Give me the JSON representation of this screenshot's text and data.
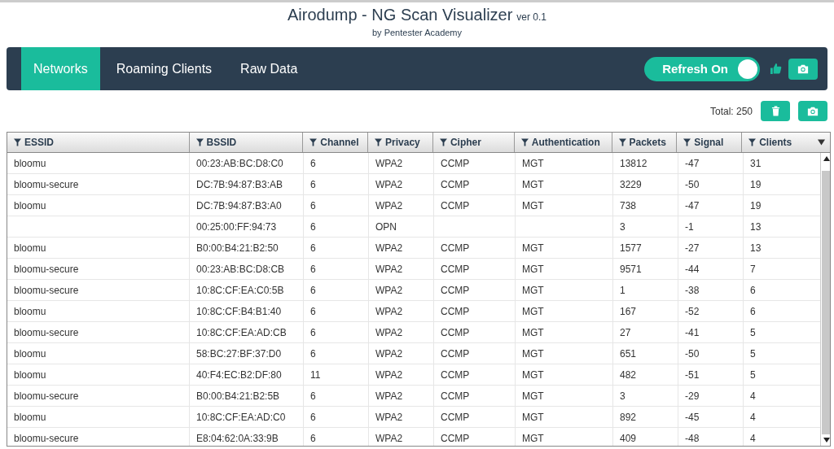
{
  "header": {
    "title": "Airodump - NG Scan Visualizer",
    "version": "ver 0.1",
    "subtitle": "by Pentester Academy"
  },
  "tabs": [
    {
      "label": "Networks",
      "selected": true
    },
    {
      "label": "Roaming Clients",
      "selected": false
    },
    {
      "label": "Raw Data",
      "selected": false
    }
  ],
  "refresh_toggle": {
    "label": "Refresh On",
    "on": true
  },
  "total": "Total: 250",
  "table": {
    "columns": [
      "ESSID",
      "BSSID",
      "Channel",
      "Privacy",
      "Cipher",
      "Authentication",
      "Packets",
      "Signal",
      "Clients"
    ],
    "rows": [
      {
        "essid": "bloomu",
        "bssid": "00:23:AB:BC:D8:C0",
        "channel": "6",
        "privacy": "WPA2",
        "cipher": "CCMP",
        "authentication": "MGT",
        "packets": "13812",
        "signal": "-47",
        "clients": "31"
      },
      {
        "essid": "bloomu-secure",
        "bssid": "DC:7B:94:87:B3:AB",
        "channel": "6",
        "privacy": "WPA2",
        "cipher": "CCMP",
        "authentication": "MGT",
        "packets": "3229",
        "signal": "-50",
        "clients": "19"
      },
      {
        "essid": "bloomu",
        "bssid": "DC:7B:94:87:B3:A0",
        "channel": "6",
        "privacy": "WPA2",
        "cipher": "CCMP",
        "authentication": "MGT",
        "packets": "738",
        "signal": "-47",
        "clients": "19"
      },
      {
        "bssid": "00:25:00:FF:94:73",
        "channel": "6",
        "privacy": "OPN",
        "packets": "3",
        "signal": "-1",
        "clients": "13"
      },
      {
        "essid": "bloomu",
        "bssid": "B0:00:B4:21:B2:50",
        "channel": "6",
        "privacy": "WPA2",
        "cipher": "CCMP",
        "authentication": "MGT",
        "packets": "1577",
        "signal": "-27",
        "clients": "13"
      },
      {
        "essid": "bloomu-secure",
        "bssid": "00:23:AB:BC:D8:CB",
        "channel": "6",
        "privacy": "WPA2",
        "cipher": "CCMP",
        "authentication": "MGT",
        "packets": "9571",
        "signal": "-44",
        "clients": "7"
      },
      {
        "essid": "bloomu-secure",
        "bssid": "10:8C:CF:EA:C0:5B",
        "channel": "6",
        "privacy": "WPA2",
        "cipher": "CCMP",
        "authentication": "MGT",
        "packets": "1",
        "signal": "-38",
        "clients": "6"
      },
      {
        "essid": "bloomu",
        "bssid": "10:8C:CF:B4:B1:40",
        "channel": "6",
        "privacy": "WPA2",
        "cipher": "CCMP",
        "authentication": "MGT",
        "packets": "167",
        "signal": "-52",
        "clients": "6"
      },
      {
        "essid": "bloomu-secure",
        "bssid": "10:8C:CF:EA:AD:CB",
        "channel": "6",
        "privacy": "WPA2",
        "cipher": "CCMP",
        "authentication": "MGT",
        "packets": "27",
        "signal": "-41",
        "clients": "5"
      },
      {
        "essid": "bloomu",
        "bssid": "58:BC:27:BF:37:D0",
        "channel": "6",
        "privacy": "WPA2",
        "cipher": "CCMP",
        "authentication": "MGT",
        "packets": "651",
        "signal": "-50",
        "clients": "5"
      },
      {
        "essid": "bloomu",
        "bssid": "40:F4:EC:B2:DF:80",
        "channel": "11",
        "privacy": "WPA2",
        "cipher": "CCMP",
        "authentication": "MGT",
        "packets": "482",
        "signal": "-51",
        "clients": "5"
      },
      {
        "essid": "bloomu-secure",
        "bssid": "B0:00:B4:21:B2:5B",
        "channel": "6",
        "privacy": "WPA2",
        "cipher": "CCMP",
        "authentication": "MGT",
        "packets": "3",
        "signal": "-29",
        "clients": "4"
      },
      {
        "essid": "bloomu",
        "bssid": "10:8C:CF:EA:AD:C0",
        "channel": "6",
        "privacy": "WPA2",
        "cipher": "CCMP",
        "authentication": "MGT",
        "packets": "892",
        "signal": "-45",
        "clients": "4"
      },
      {
        "essid": "bloomu-secure",
        "bssid": "E8:04:62:0A:33:9B",
        "channel": "6",
        "privacy": "WPA2",
        "cipher": "CCMP",
        "authentication": "MGT",
        "packets": "409",
        "signal": "-48",
        "clients": "4"
      }
    ]
  }
}
